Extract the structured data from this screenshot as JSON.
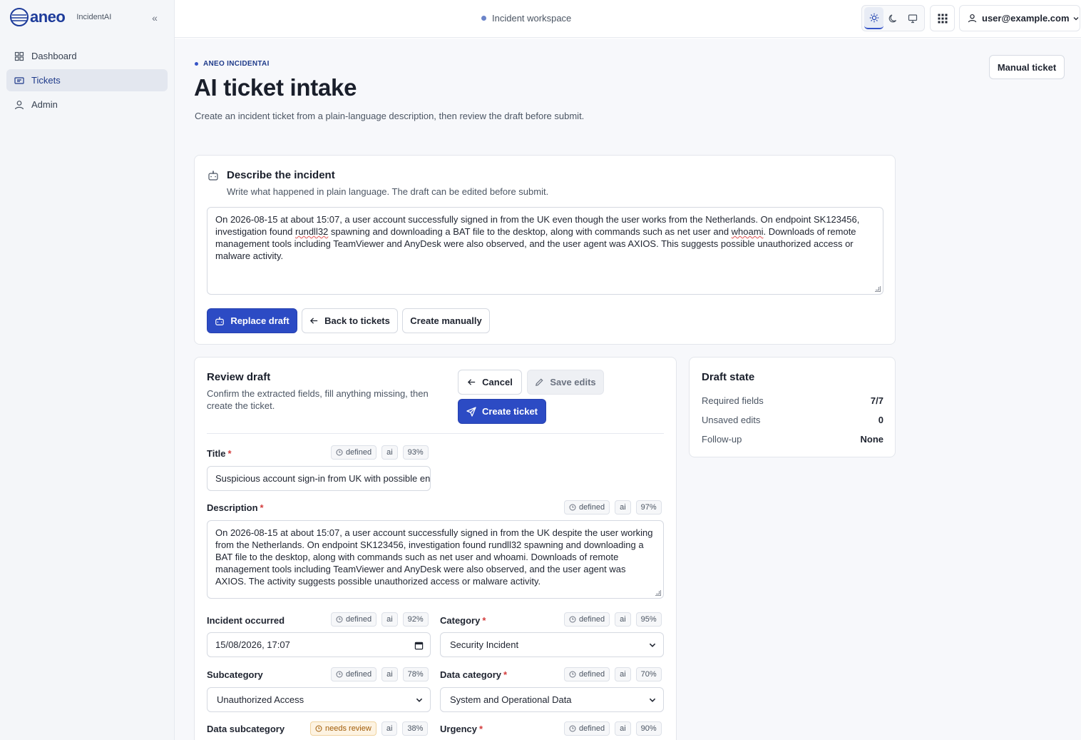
{
  "brand": {
    "name": "aneo",
    "product": "IncidentAI"
  },
  "sidebar": {
    "items": [
      {
        "label": "Dashboard",
        "icon": "dashboard-icon",
        "active": false
      },
      {
        "label": "Tickets",
        "icon": "ticket-icon",
        "active": true
      },
      {
        "label": "Admin",
        "icon": "user-icon",
        "active": false
      }
    ]
  },
  "topbar": {
    "workspace": "Incident workspace",
    "theme_buttons": [
      "sun-icon",
      "moon-icon",
      "monitor-icon"
    ],
    "active_theme": "light",
    "user": "user@example.com"
  },
  "header": {
    "eyebrow": "ANEO INCIDENTAI",
    "title": "AI ticket intake",
    "subtitle": "Create an incident ticket from a plain-language description, then review the draft before submit.",
    "manual_button": "Manual ticket"
  },
  "describe": {
    "title": "Describe the incident",
    "subtitle": "Write what happened in plain language. The draft can be edited before submit.",
    "text_before": "On 2026-08-15 at about 15:07, a user account successfully signed in from the UK even though the user works from the Netherlands. On endpoint SK123456, investigation found ",
    "squiggle_1": "rundll32",
    "text_middle": " spawning and downloading a BAT file to the desktop, along with commands such as net user and ",
    "squiggle_2": "whoami",
    "text_after": ". Downloads of remote management tools including TeamViewer and AnyDesk were also observed, and the user agent was AXIOS. This suggests possible unauthorized access or malware activity.",
    "replace_button": "Replace draft",
    "back_button": "Back to tickets",
    "create_manual_button": "Create manually"
  },
  "review": {
    "title": "Review draft",
    "subtitle": "Confirm the extracted fields, fill anything missing, then create the ticket.",
    "cancel_button": "Cancel",
    "save_button": "Save edits",
    "create_button": "Create ticket",
    "fields": {
      "title": {
        "label": "Title",
        "required": true,
        "status": "defined",
        "source": "ai",
        "confidence": "93%",
        "value": "Suspicious account sign-in from UK with possible endpoint compromise"
      },
      "description": {
        "label": "Description",
        "required": true,
        "status": "defined",
        "source": "ai",
        "confidence": "97%",
        "value": "On 2026-08-15 at about 15:07, a user account successfully signed in from the UK despite the user working from the Netherlands. On endpoint SK123456, investigation found rundll32 spawning and downloading a BAT file to the desktop, along with commands such as net user and whoami. Downloads of remote management tools including TeamViewer and AnyDesk were also observed, and the user agent was AXIOS. The activity suggests possible unauthorized access or malware activity."
      },
      "incident_occurred": {
        "label": "Incident occurred",
        "required": false,
        "status": "defined",
        "source": "ai",
        "confidence": "92%",
        "value": "15/08/2026, 17:07"
      },
      "category": {
        "label": "Category",
        "required": true,
        "status": "defined",
        "source": "ai",
        "confidence": "95%",
        "value": "Security Incident"
      },
      "subcategory": {
        "label": "Subcategory",
        "required": false,
        "status": "defined",
        "source": "ai",
        "confidence": "78%",
        "value": "Unauthorized Access"
      },
      "data_category": {
        "label": "Data category",
        "required": true,
        "status": "defined",
        "source": "ai",
        "confidence": "70%",
        "value": "System and Operational Data"
      },
      "data_subcategory": {
        "label": "Data subcategory",
        "required": false,
        "status": "needs review",
        "source": "ai",
        "confidence": "38%"
      },
      "urgency": {
        "label": "Urgency",
        "required": true,
        "status": "defined",
        "source": "ai",
        "confidence": "90%"
      }
    }
  },
  "draft_state": {
    "title": "Draft state",
    "rows": [
      {
        "label": "Required fields",
        "value": "7/7"
      },
      {
        "label": "Unsaved edits",
        "value": "0"
      },
      {
        "label": "Follow-up",
        "value": "None"
      }
    ]
  },
  "colors": {
    "primary": "#2c4bc4",
    "brand": "#1d3b9a",
    "required": "#d33c3c",
    "warning": "#a15c07"
  }
}
